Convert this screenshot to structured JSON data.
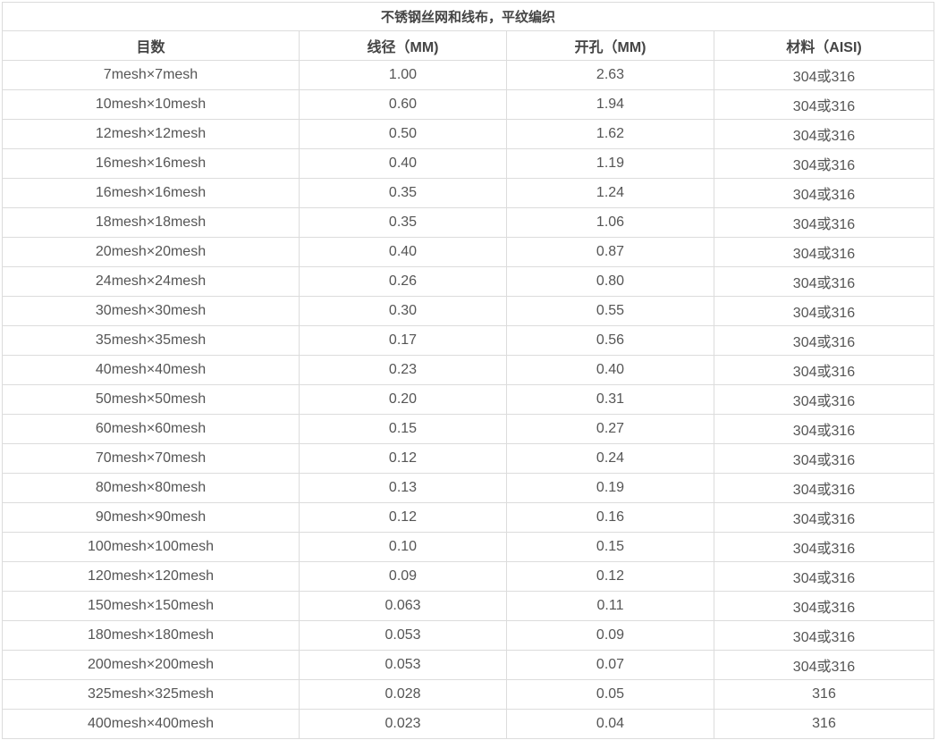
{
  "table": {
    "title": "不锈钢丝网和线布，平纹编织",
    "headers": [
      "目数",
      "线径（MM)",
      "开孔（MM)",
      "材料（AISI)"
    ],
    "rows": [
      [
        "7mesh×7mesh",
        "1.00",
        "2.63",
        "304或316"
      ],
      [
        "10mesh×10mesh",
        "0.60",
        "1.94",
        "304或316"
      ],
      [
        "12mesh×12mesh",
        "0.50",
        "1.62",
        "304或316"
      ],
      [
        "16mesh×16mesh",
        "0.40",
        "1.19",
        "304或316"
      ],
      [
        "16mesh×16mesh",
        "0.35",
        "1.24",
        "304或316"
      ],
      [
        "18mesh×18mesh",
        "0.35",
        "1.06",
        "304或316"
      ],
      [
        "20mesh×20mesh",
        "0.40",
        "0.87",
        "304或316"
      ],
      [
        "24mesh×24mesh",
        "0.26",
        "0.80",
        "304或316"
      ],
      [
        "30mesh×30mesh",
        "0.30",
        "0.55",
        "304或316"
      ],
      [
        "35mesh×35mesh",
        "0.17",
        "0.56",
        "304或316"
      ],
      [
        "40mesh×40mesh",
        "0.23",
        "0.40",
        "304或316"
      ],
      [
        "50mesh×50mesh",
        "0.20",
        "0.31",
        "304或316"
      ],
      [
        "60mesh×60mesh",
        "0.15",
        "0.27",
        "304或316"
      ],
      [
        "70mesh×70mesh",
        "0.12",
        "0.24",
        "304或316"
      ],
      [
        "80mesh×80mesh",
        "0.13",
        "0.19",
        "304或316"
      ],
      [
        "90mesh×90mesh",
        "0.12",
        "0.16",
        "304或316"
      ],
      [
        "100mesh×100mesh",
        "0.10",
        "0.15",
        "304或316"
      ],
      [
        "120mesh×120mesh",
        "0.09",
        "0.12",
        "304或316"
      ],
      [
        "150mesh×150mesh",
        "0.063",
        "0.11",
        "304或316"
      ],
      [
        "180mesh×180mesh",
        "0.053",
        "0.09",
        "304或316"
      ],
      [
        "200mesh×200mesh",
        "0.053",
        "0.07",
        "304或316"
      ],
      [
        "325mesh×325mesh",
        "0.028",
        "0.05",
        "316"
      ],
      [
        "400mesh×400mesh",
        "0.023",
        "0.04",
        "316"
      ]
    ]
  }
}
